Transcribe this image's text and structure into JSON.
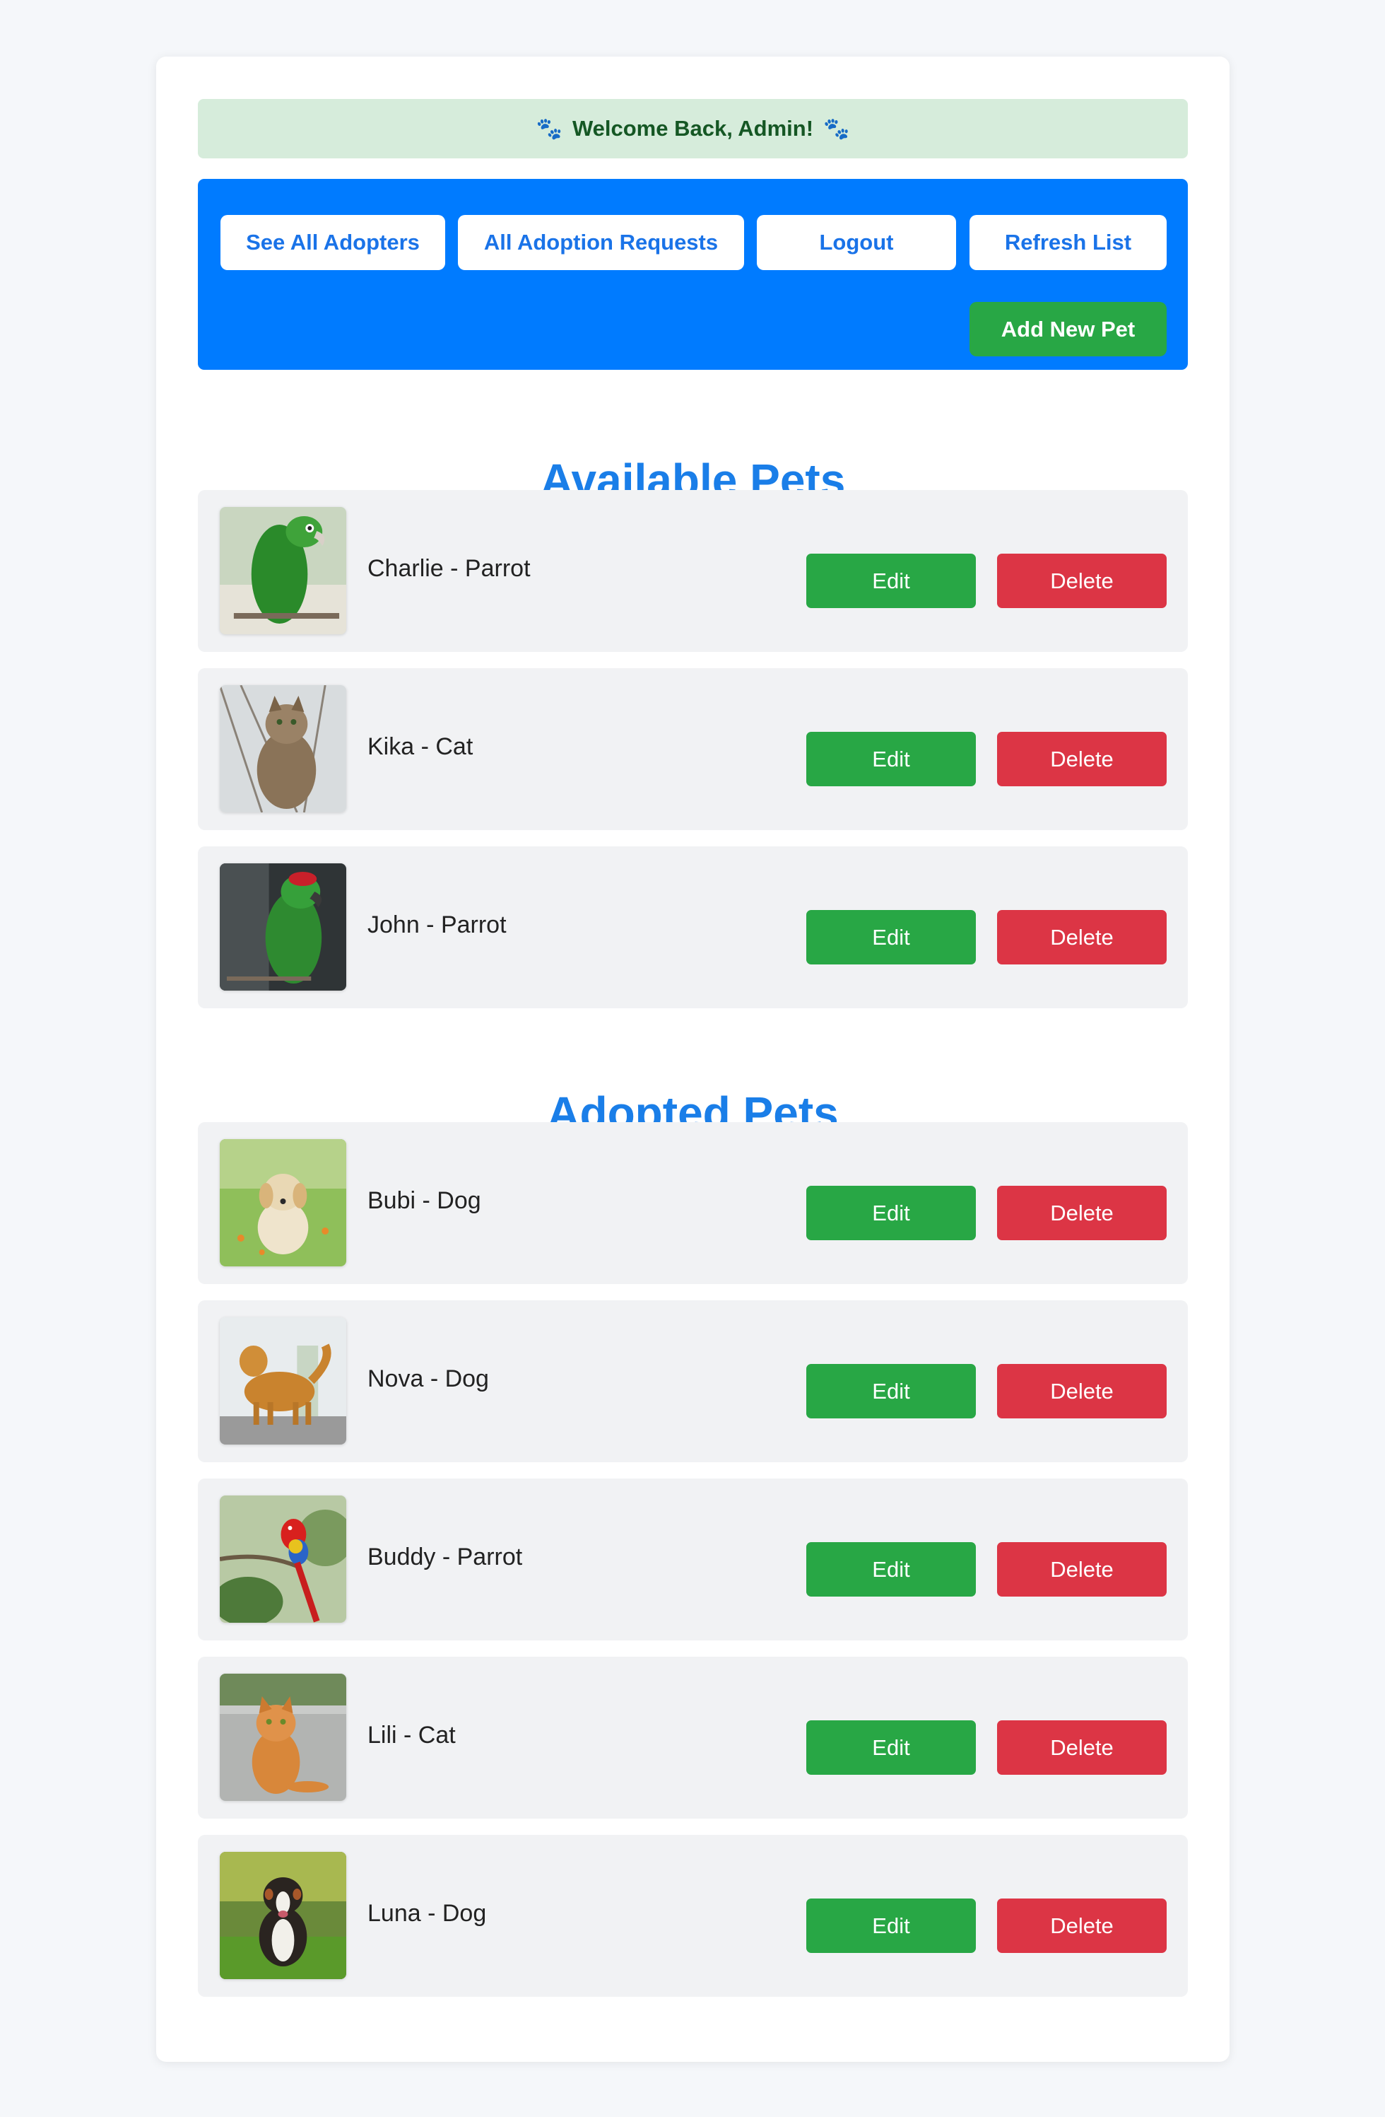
{
  "welcome": {
    "text": "Welcome Back, Admin!",
    "paw_left": "🐾",
    "paw_right": "🐾"
  },
  "toolbar": {
    "see_all_adopters": "See All Adopters",
    "all_adoption_requests": "All Adoption Requests",
    "logout": "Logout",
    "refresh_list": "Refresh List",
    "add_new_pet": "Add New Pet"
  },
  "available": {
    "title": "Available Pets",
    "pets": [
      {
        "name": "Charlie - Parrot",
        "image": "green-parrot-photo"
      },
      {
        "name": "Kika - Cat",
        "image": "tabby-cat-photo"
      },
      {
        "name": "John - Parrot",
        "image": "green-parrot-dark-photo"
      }
    ]
  },
  "adopted": {
    "title": "Adopted Pets",
    "pets": [
      {
        "name": "Bubi - Dog",
        "image": "golden-puppy-photo"
      },
      {
        "name": "Nova - Dog",
        "image": "golden-retriever-photo"
      },
      {
        "name": "Buddy - Parrot",
        "image": "scarlet-macaw-photo"
      },
      {
        "name": "Lili - Cat",
        "image": "orange-cat-photo"
      },
      {
        "name": "Luna - Dog",
        "image": "australian-shepherd-photo"
      }
    ]
  },
  "actions": {
    "edit": "Edit",
    "delete": "Delete"
  },
  "colors": {
    "primary_blue": "#007bff",
    "title_blue": "#1a7ee8",
    "success_green": "#28a745",
    "danger_red": "#dc3545",
    "welcome_bg": "#d6ecdb",
    "welcome_text": "#155724"
  }
}
